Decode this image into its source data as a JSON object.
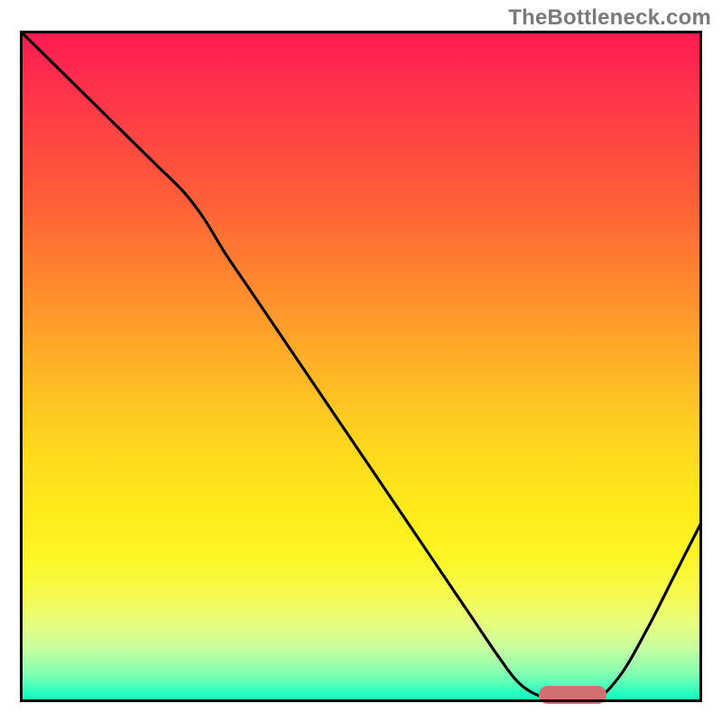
{
  "watermark": "TheBottleneck.com",
  "colors": {
    "frame": "#000000",
    "curve": "#000000",
    "marker": "#d07070",
    "gradient_top": "#ff1a52",
    "gradient_mid": "#ffe81a",
    "gradient_bottom": "#1affc2"
  },
  "chart_data": {
    "type": "line",
    "title": "",
    "xlabel": "",
    "ylabel": "",
    "xlim": [
      0,
      100
    ],
    "ylim": [
      0,
      100
    ],
    "grid": false,
    "legend": false,
    "x": [
      0,
      4,
      8,
      12,
      16,
      20,
      24,
      27,
      30,
      34,
      38,
      42,
      46,
      50,
      54,
      58,
      62,
      66,
      70,
      73,
      76,
      80,
      84,
      88,
      92,
      96,
      100
    ],
    "values": [
      100,
      96,
      92,
      88,
      84,
      80,
      76,
      72,
      67,
      61,
      55,
      49,
      43,
      37,
      31,
      25,
      19,
      13,
      7,
      3,
      1,
      0,
      0,
      4,
      11,
      19,
      27
    ],
    "marker": {
      "x_start": 76,
      "x_end": 86,
      "y": 0
    },
    "notes": "y represents height above the bottom edge as a percentage of the plot; curve descends from the top-left corner with a slight knee near x≈27, bottoms out around x≈76–86, then rises toward the right edge."
  }
}
